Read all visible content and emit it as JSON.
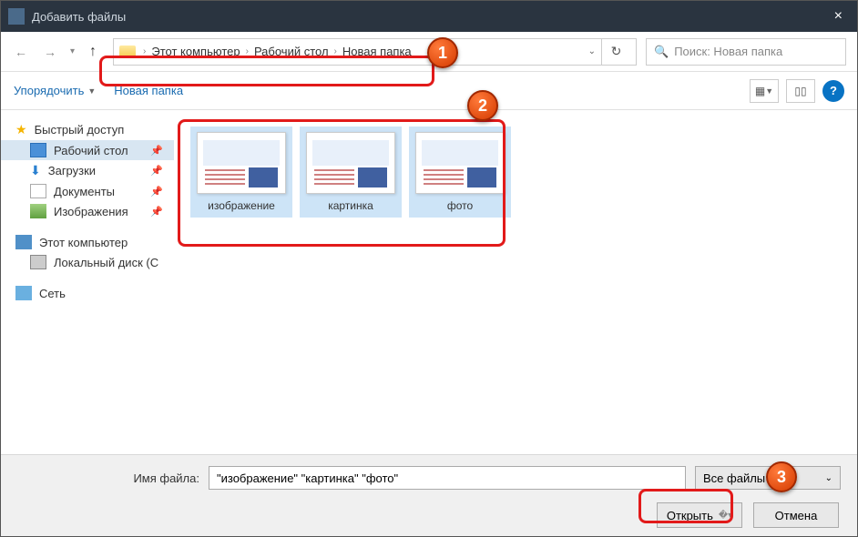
{
  "window": {
    "title": "Добавить файлы"
  },
  "breadcrumb": {
    "parts": [
      "Этот компьютер",
      "Рабочий стол",
      "Новая папка"
    ]
  },
  "search": {
    "placeholder": "Поиск: Новая папка"
  },
  "toolbar": {
    "organize": "Упорядочить",
    "new_folder": "Новая папка"
  },
  "sidebar": {
    "quick_access": "Быстрый доступ",
    "desktop": "Рабочий стол",
    "downloads": "Загрузки",
    "documents": "Документы",
    "pictures": "Изображения",
    "this_pc": "Этот компьютер",
    "local_disk": "Локальный диск (C",
    "network": "Сеть"
  },
  "files": [
    {
      "name": "изображение"
    },
    {
      "name": "картинка"
    },
    {
      "name": "фото"
    }
  ],
  "bottom": {
    "filename_label": "Имя файла:",
    "filename_value": "\"изображение\" \"картинка\" \"фото\"",
    "filter": "Все файлы (*.*)",
    "open": "Открыть",
    "cancel": "Отмена"
  },
  "callouts": {
    "c1": "1",
    "c2": "2",
    "c3": "3"
  }
}
